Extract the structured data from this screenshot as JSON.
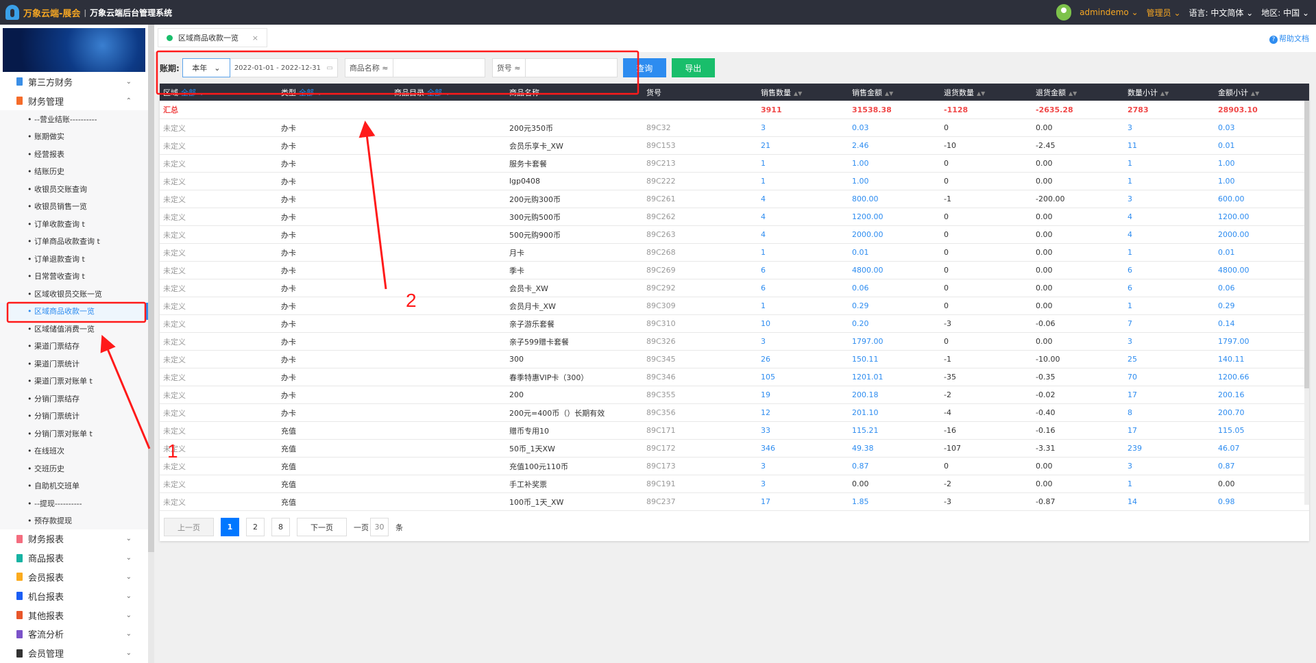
{
  "topbar": {
    "brand": "万象云端-展会",
    "divider": "|",
    "system": "万象云端后台管理系统",
    "user": "admindemo ⌄",
    "role": "管理员 ⌄",
    "lang_label": "语言:",
    "lang": "中文简体 ⌄",
    "region_label": "地区:",
    "region": "中国 ⌄"
  },
  "sidebar": {
    "top": [
      {
        "label": "第三方财务",
        "color": "#3a8ee6",
        "chev": "⌄"
      },
      {
        "label": "财务管理",
        "color": "#f56c2a",
        "chev": "⌃"
      }
    ],
    "sub": [
      "• --营业结账----------",
      "• 账期做实",
      "• 经营报表",
      "• 结账历史",
      "• 收银员交账查询",
      "• 收银员销售一览",
      "• 订单收款查询 t",
      "• 订单商品收款查询 t",
      "• 订单退款查询 t",
      "• 日常营收查询 t",
      "• 区域收银员交账一览",
      "• 区域商品收款一览",
      "• 区域储值消费一览",
      "• 渠道门票结存",
      "• 渠道门票统计",
      "• 渠道门票对账单 t",
      "• 分销门票结存",
      "• 分销门票统计",
      "• 分销门票对账单 t",
      "• 在线班次",
      "• 交班历史",
      "• 自助机交班单",
      "• --提现----------",
      "• 预存款提现"
    ],
    "active_index": 11,
    "bottom": [
      {
        "label": "财务报表",
        "color": "#f46d7f"
      },
      {
        "label": "商品报表",
        "color": "#17b3a3"
      },
      {
        "label": "会员报表",
        "color": "#fbab1e"
      },
      {
        "label": "机台报表",
        "color": "#1b5ef5"
      },
      {
        "label": "其他报表",
        "color": "#e8562a"
      },
      {
        "label": "客流分析",
        "color": "#7b53c9"
      },
      {
        "label": "会员管理",
        "color": "#333333"
      }
    ],
    "chev": "⌄"
  },
  "tabs": {
    "active": "区域商品收款一览",
    "close": "×",
    "help": "帮助文档",
    "help_icon": "?"
  },
  "filters": {
    "period_label": "账期:",
    "period": "本年",
    "period_chev": "⌄",
    "date_range": "2022-01-01 - 2022-12-31",
    "cal_icon": "▭",
    "name_label": "商品名称 ≈",
    "code_label": "货号 ≈",
    "query": "查询",
    "export": "导出"
  },
  "table": {
    "headers": [
      {
        "t": "区域",
        "f": "全部 ⌄"
      },
      {
        "t": "类型",
        "f": "全部 ⌄"
      },
      {
        "t": "商品目录",
        "f": "全部 ⌄"
      },
      {
        "t": "商品名称"
      },
      {
        "t": "货号"
      },
      {
        "t": "销售数量",
        "s": 1
      },
      {
        "t": "销售金额",
        "s": 1
      },
      {
        "t": "退货数量",
        "s": 1
      },
      {
        "t": "退货金额",
        "s": 1
      },
      {
        "t": "数量小计",
        "s": 1
      },
      {
        "t": "金额小计",
        "s": 1
      }
    ],
    "summary": [
      "汇总",
      "",
      "",
      "",
      "",
      "3911",
      "31538.38",
      "-1128",
      "-2635.28",
      "2783",
      "28903.10"
    ],
    "rows": [
      [
        "未定义",
        "办卡",
        "",
        "200元350币",
        "89C32",
        "3",
        "0.03",
        "0",
        "0.00",
        "3",
        "0.03"
      ],
      [
        "未定义",
        "办卡",
        "",
        "会员乐享卡_XW",
        "89C153",
        "21",
        "2.46",
        "-10",
        "-2.45",
        "11",
        "0.01"
      ],
      [
        "未定义",
        "办卡",
        "",
        "服务卡套餐",
        "89C213",
        "1",
        "1.00",
        "0",
        "0.00",
        "1",
        "1.00"
      ],
      [
        "未定义",
        "办卡",
        "",
        "lgp0408",
        "89C222",
        "1",
        "1.00",
        "0",
        "0.00",
        "1",
        "1.00"
      ],
      [
        "未定义",
        "办卡",
        "",
        "200元购300币",
        "89C261",
        "4",
        "800.00",
        "-1",
        "-200.00",
        "3",
        "600.00"
      ],
      [
        "未定义",
        "办卡",
        "",
        "300元购500币",
        "89C262",
        "4",
        "1200.00",
        "0",
        "0.00",
        "4",
        "1200.00"
      ],
      [
        "未定义",
        "办卡",
        "",
        "500元购900币",
        "89C263",
        "4",
        "2000.00",
        "0",
        "0.00",
        "4",
        "2000.00"
      ],
      [
        "未定义",
        "办卡",
        "",
        "月卡",
        "89C268",
        "1",
        "0.01",
        "0",
        "0.00",
        "1",
        "0.01"
      ],
      [
        "未定义",
        "办卡",
        "",
        "季卡",
        "89C269",
        "6",
        "4800.00",
        "0",
        "0.00",
        "6",
        "4800.00"
      ],
      [
        "未定义",
        "办卡",
        "",
        "会员卡_XW",
        "89C292",
        "6",
        "0.06",
        "0",
        "0.00",
        "6",
        "0.06"
      ],
      [
        "未定义",
        "办卡",
        "",
        "会员月卡_XW",
        "89C309",
        "1",
        "0.29",
        "0",
        "0.00",
        "1",
        "0.29"
      ],
      [
        "未定义",
        "办卡",
        "",
        "亲子游乐套餐",
        "89C310",
        "10",
        "0.20",
        "-3",
        "-0.06",
        "7",
        "0.14"
      ],
      [
        "未定义",
        "办卡",
        "",
        "亲子599赠卡套餐",
        "89C326",
        "3",
        "1797.00",
        "0",
        "0.00",
        "3",
        "1797.00"
      ],
      [
        "未定义",
        "办卡",
        "",
        "300",
        "89C345",
        "26",
        "150.11",
        "-1",
        "-10.00",
        "25",
        "140.11"
      ],
      [
        "未定义",
        "办卡",
        "",
        "春季特惠VIP卡（300）",
        "89C346",
        "105",
        "1201.01",
        "-35",
        "-0.35",
        "70",
        "1200.66"
      ],
      [
        "未定义",
        "办卡",
        "",
        "200",
        "89C355",
        "19",
        "200.18",
        "-2",
        "-0.02",
        "17",
        "200.16"
      ],
      [
        "未定义",
        "办卡",
        "",
        "200元=400币（）长期有效",
        "89C356",
        "12",
        "201.10",
        "-4",
        "-0.40",
        "8",
        "200.70"
      ],
      [
        "未定义",
        "充值",
        "",
        "赠币专用10",
        "89C171",
        "33",
        "115.21",
        "-16",
        "-0.16",
        "17",
        "115.05"
      ],
      [
        "未定义",
        "充值",
        "",
        "50币_1天XW",
        "89C172",
        "346",
        "49.38",
        "-107",
        "-3.31",
        "239",
        "46.07"
      ],
      [
        "未定义",
        "充值",
        "",
        "充值100元110币",
        "89C173",
        "3",
        "0.87",
        "0",
        "0.00",
        "3",
        "0.87"
      ],
      [
        "未定义",
        "充值",
        "",
        "手工补奖票",
        "89C191",
        "3",
        "0.00",
        "-2",
        "0.00",
        "1",
        "0.00"
      ],
      [
        "未定义",
        "充值",
        "",
        "100币_1天_XW",
        "89C237",
        "17",
        "1.85",
        "-3",
        "-0.87",
        "14",
        "0.98"
      ]
    ]
  },
  "pager": {
    "prev": "上一页",
    "pages": [
      "1",
      "2",
      "8"
    ],
    "current": "1",
    "next": "下一页",
    "per_label": "一页",
    "per": "30",
    "unit": "条"
  },
  "annotations": {
    "label1": "1",
    "label2": "2",
    "color": "#ff1a1a"
  }
}
